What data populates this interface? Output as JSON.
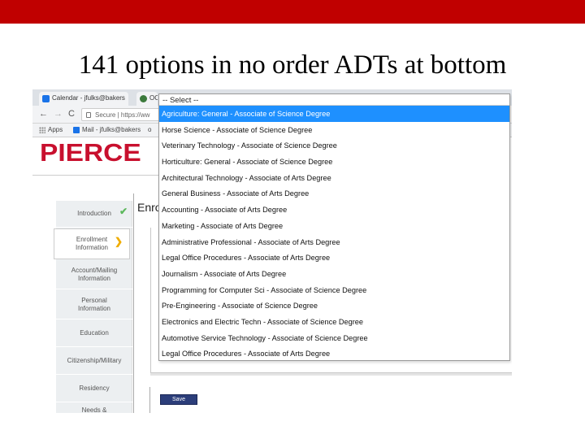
{
  "slide": {
    "title": "141 options in no order ADTs at bottom",
    "accent_color": "#c00000"
  },
  "browser": {
    "tabs": [
      {
        "label": "Calendar - jfulks@bakers"
      },
      {
        "label": "OC"
      }
    ],
    "url": "Secure | https://ww",
    "bookmarks": {
      "apps": "Apps",
      "mail": "Mail - jfulks@bakers",
      "more": "o"
    }
  },
  "logo": {
    "text": "PIERCE"
  },
  "sidebar": {
    "items": [
      {
        "label": "Introduction",
        "status": "check-icon"
      },
      {
        "label": "Enrollment Information",
        "status": "arrow-icon"
      },
      {
        "label": "Account/Mailing Information"
      },
      {
        "label": "Personal Information"
      },
      {
        "label": "Education"
      },
      {
        "label": "Citizenship/Military"
      },
      {
        "label": "Residency"
      },
      {
        "label": "Needs &"
      }
    ]
  },
  "form": {
    "heading": "Enro",
    "save_label": "Save"
  },
  "dropdown": {
    "header": "-- Select --",
    "options": [
      "Agriculture: General - Associate of Science Degree",
      "Horse Science - Associate of Science Degree",
      "Veterinary Technology - Associate of Science Degree",
      "Horticulture: General - Associate of Science Degree",
      "Architectural Technology - Associate of Arts Degree",
      "General Business - Associate of Arts Degree",
      "Accounting - Associate of Arts Degree",
      "Marketing - Associate of Arts Degree",
      "Administrative Professional - Associate of Arts Degree",
      "Legal Office Procedures - Associate of Arts Degree",
      "Journalism - Associate of Arts Degree",
      "Programming for Computer Sci - Associate of Science Degree",
      "Pre-Engineering - Associate of Science Degree",
      "Electronics and Electric Techn - Associate of Science Degree",
      "Automotive Service Technology - Associate of Science Degree",
      "Legal Office Procedures - Associate of Arts Degree"
    ],
    "selected_index": 0
  }
}
